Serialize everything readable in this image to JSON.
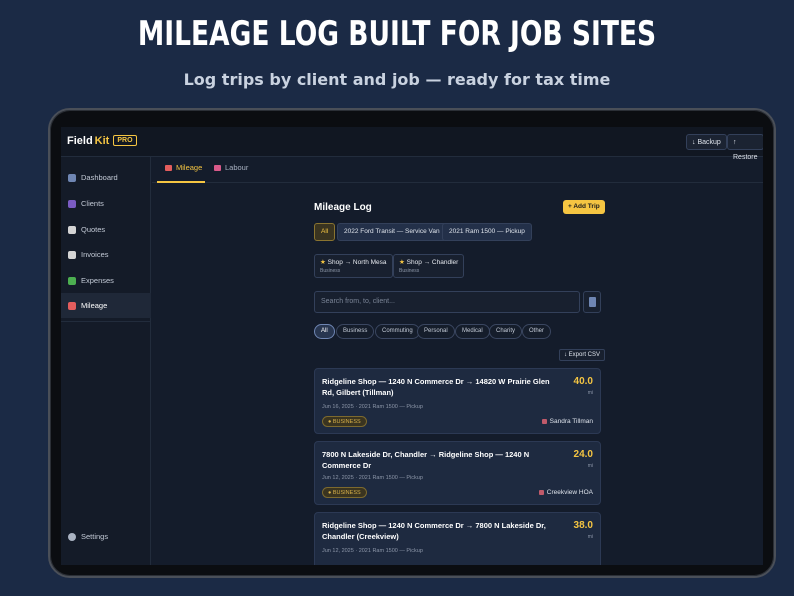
{
  "promo": {
    "headline": "MILEAGE LOG BUILT FOR JOB SITES",
    "subhead": "Log trips by client and job — ready for tax time"
  },
  "app": {
    "logo_field": "Field",
    "logo_kit": "Kit",
    "logo_badge": "PRO",
    "backup_label": "↓ Backup",
    "restore_label": "↑ Restore"
  },
  "sidebar": {
    "items": [
      {
        "label": "Dashboard",
        "icon": "dashboard-icon",
        "color": "#6f86b3"
      },
      {
        "label": "Clients",
        "icon": "clients-icon",
        "color": "#7b5cc4"
      },
      {
        "label": "Quotes",
        "icon": "quotes-icon",
        "color": "#d4d4d4"
      },
      {
        "label": "Invoices",
        "icon": "invoices-icon",
        "color": "#d4d4d4"
      },
      {
        "label": "Expenses",
        "icon": "expenses-icon",
        "color": "#4caf50"
      },
      {
        "label": "Mileage",
        "icon": "car-icon",
        "color": "#e35d5d"
      }
    ],
    "settings_label": "Settings"
  },
  "tabs": [
    {
      "label": "Mileage",
      "icon": "car-icon"
    },
    {
      "label": "Labour",
      "icon": "labour-icon"
    }
  ],
  "main": {
    "title": "Mileage Log",
    "add_trip_label": "+ Add Trip",
    "vehicles": [
      "All",
      "2022 Ford Transit — Service Van",
      "2021 Ram 1500 — Pickup"
    ],
    "favorites": [
      {
        "route": "Shop → North Mesa",
        "category": "Business"
      },
      {
        "route": "Shop → Chandler",
        "category": "Business"
      }
    ],
    "search_placeholder": "Search from, to, client...",
    "filters": [
      "All",
      "Business",
      "Commuting",
      "Personal",
      "Medical",
      "Charity",
      "Other"
    ],
    "export_label": "↓ Export CSV"
  },
  "trips": [
    {
      "route": "Ridgeline Shop — 1240 N Commerce Dr → 14820 W Prairie Glen Rd, Gilbert (Tillman)",
      "distance": "40.0",
      "unit": "mi",
      "meta": "Jun 16, 2025 · 2021 Ram 1500 — Pickup",
      "badge": "● BUSINESS",
      "client": "Sandra Tillman"
    },
    {
      "route": "7800 N Lakeside Dr, Chandler → Ridgeline Shop — 1240 N Commerce Dr",
      "distance": "24.0",
      "unit": "mi",
      "meta": "Jun 12, 2025 · 2021 Ram 1500 — Pickup",
      "badge": "● BUSINESS",
      "client": "Creekview HOA"
    },
    {
      "route": "Ridgeline Shop — 1240 N Commerce Dr → 7800 N Lakeside Dr, Chandler (Creekview)",
      "distance": "38.0",
      "unit": "mi",
      "meta": "Jun 12, 2025 · 2021 Ram 1500 — Pickup"
    }
  ]
}
